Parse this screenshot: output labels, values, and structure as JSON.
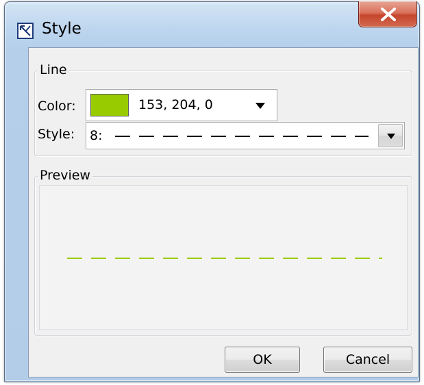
{
  "window": {
    "title": "Style",
    "icon": "diagram-style-icon",
    "close_glyph": "X"
  },
  "line_group": {
    "legend": "Line",
    "color": {
      "label": "Color:",
      "value": "153, 204, 0",
      "swatch": "#99cc00"
    },
    "style": {
      "label": "Style:",
      "selected": "8:"
    }
  },
  "preview_group": {
    "legend": "Preview",
    "line_color": "#99cc00"
  },
  "buttons": {
    "ok": "OK",
    "cancel": "Cancel"
  }
}
